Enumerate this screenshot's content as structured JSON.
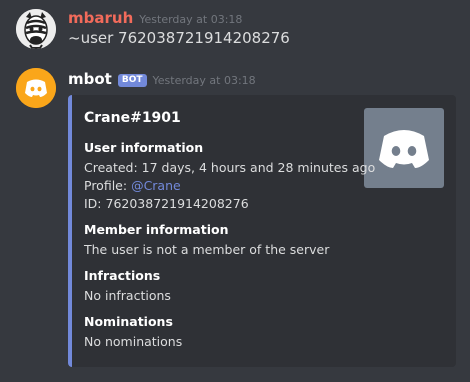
{
  "messages": [
    {
      "username": "mbaruh",
      "username_color": "#f26b5b",
      "timestamp": "Yesterday at 03:18",
      "content": "~user 762038721914208276",
      "avatar_icon": "zebra-avatar-icon"
    },
    {
      "username": "mbot",
      "username_color": "#ffffff",
      "bot_tag": "BOT",
      "timestamp": "Yesterday at 03:18",
      "avatar_icon": "discord-logo-icon",
      "embed": {
        "accent_color": "#7289da",
        "title": "Crane#1901",
        "thumbnail_icon": "discord-logo-icon",
        "user_information": {
          "name": "User information",
          "created": "Created: 17 days, 4 hours and 28 minutes ago",
          "profile_label": "Profile: ",
          "profile_mention": "@Crane",
          "id": "ID: 762038721914208276"
        },
        "member_information": {
          "name": "Member information",
          "value": "The user is not a member of the server"
        },
        "infractions": {
          "name": "Infractions",
          "value": "No infractions"
        },
        "nominations": {
          "name": "Nominations",
          "value": "No nominations"
        }
      }
    }
  ]
}
